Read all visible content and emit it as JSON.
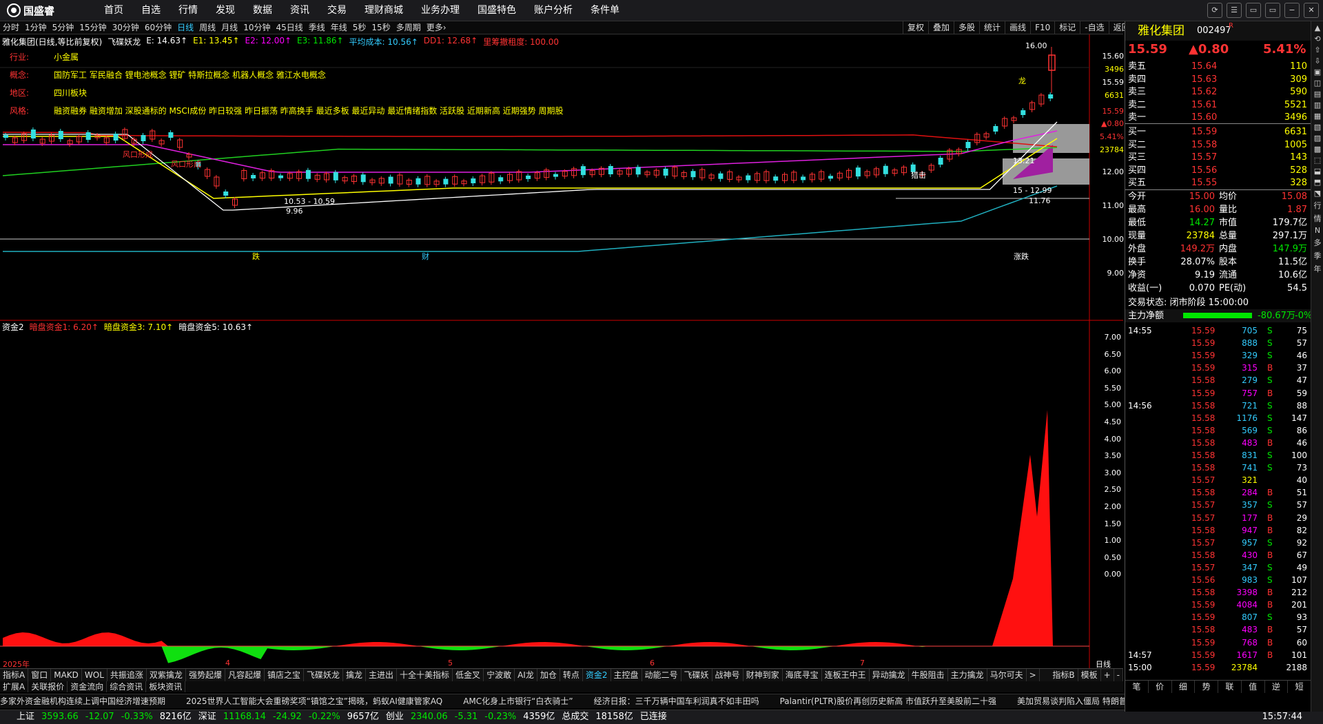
{
  "topbar": {
    "logo": "国盛睿",
    "menu": [
      "首页",
      "自选",
      "行情",
      "发现",
      "数据",
      "资讯",
      "交易",
      "理财商城",
      "业务办理",
      "国盛特色",
      "账户分析",
      "条件单"
    ],
    "window_buttons": [
      "⟳",
      "☰",
      "▭",
      "▭",
      "−",
      "✕"
    ]
  },
  "periods": [
    "分时",
    "1分钟",
    "5分钟",
    "15分钟",
    "30分钟",
    "60分钟",
    "日线",
    "周线",
    "月线",
    "10分钟",
    "45日线",
    "季线",
    "年线",
    "5秒",
    "15秒",
    "多周期",
    "更多›"
  ],
  "active_period": "日线",
  "right_tools": [
    "复权",
    "叠加",
    "多股",
    "统计",
    "画线",
    "F10",
    "标记",
    "-自选",
    "返回"
  ],
  "info_line": {
    "stock": "雅化集团(日线,等比前复权)",
    "indicator": "飞碟妖龙",
    "E": "E: 14.63↑",
    "E1": "E1: 13.45↑",
    "E2": "E2: 12.00↑",
    "E3": "E3: 11.86↑",
    "avg_cost": "平均成本: 10.56↑",
    "DD1": "DD1: 12.68↑",
    "lock": "里筹撤租度: 100.00"
  },
  "stock_profile": [
    {
      "label": "行业:",
      "value": "小金属"
    },
    {
      "label": "概念:",
      "value": "国防军工 军民融合 锂电池概念 锂矿 特斯拉概念 机器人概念 雅江水电概念"
    },
    {
      "label": "地区:",
      "value": "四川板块"
    },
    {
      "label": "风格:",
      "value": "融资融券 融资增加 深股通标的 MSCI成份 昨日较强 昨日振荡 昨高换手 最近多板 最近异动 最近情绪指数 活跃股 近期新高 近期强势 周期股"
    }
  ],
  "price_axis": [
    "15.60",
    "3496",
    "15.59",
    "6631",
    "15.59",
    "▲0.80",
    "5.41%",
    "23784",
    "12.00",
    "11.00",
    "10.00",
    "9.00"
  ],
  "price_annotations": {
    "high": "16.00",
    "low_range": "10.53 - 10.59",
    "low": "9.96",
    "mid1": "13.21",
    "mid2": "15 - 12.99",
    "mid3": "11.76",
    "wind1": "风口形成",
    "wind2": "风口形成",
    "dragon": "龙",
    "hunt": "猎击",
    "event1": "跌",
    "event2": "财",
    "event3": "涨跌"
  },
  "sub_indicator": {
    "name": "资金2",
    "v1": "暗盘资金1: 6.20↑",
    "v2": "暗盘资金3: 7.10↑",
    "v3": "暗盘资金5: 10.63↑"
  },
  "sub_axis": [
    "7.00",
    "6.50",
    "6.00",
    "5.50",
    "5.00",
    "4.50",
    "4.00",
    "3.50",
    "3.00",
    "2.50",
    "2.00",
    "1.50",
    "1.00",
    "0.50",
    "0.00"
  ],
  "date_axis": [
    "2025年",
    "4",
    "5",
    "6",
    "7"
  ],
  "date_right": "日线",
  "tabs_row1": [
    "指标A",
    "窗口",
    "MAKD",
    "WOL",
    "共振追涨",
    "双紫擒龙",
    "强势起爆",
    "凡容起爆",
    "镇店之宝",
    "飞碟妖龙",
    "擒龙",
    "主进出",
    "十全十美指标",
    "低金叉",
    "宁波敢",
    "AI龙",
    "加仓",
    "转点",
    "资金2",
    "主控盘",
    "动能二号",
    "飞碟妖",
    "战神号",
    "财神到家",
    "海底寻宝",
    "连板王中王",
    "异动擒龙",
    "牛股阻击",
    "主力擒龙",
    "马尔可夫",
    ">"
  ],
  "tabs_row1_right": [
    "指标B",
    "模板",
    "+",
    "-"
  ],
  "tabs_row2": [
    "扩展A",
    "关联报价",
    "资金流向",
    "综合资讯",
    "板块资讯"
  ],
  "news": [
    "多家外资金融机构连续上调中国经济增速预期",
    "2025世界人工智能大会重磅奖项“镇馆之宝”揭晓，蚂蚁AI健康管家AQ",
    "AMC化身上市银行“白衣骑士”",
    "经济日报：三千万辆中国车利润真不如丰田吗",
    "Palantir(PLTR)股价再创历史新高 市值跃升至美股前二十强",
    "美加贸易谈判陷入僵局 特朗普威胁对加拿大征收更高关税"
  ],
  "status": {
    "sh_label": "上证",
    "sh_price": "3593.66",
    "sh_chg": "-12.07",
    "sh_pct": "-0.33%",
    "sh_amt": "8216亿",
    "sz_label": "深证",
    "sz_price": "11168.14",
    "sz_chg": "-24.92",
    "sz_pct": "-0.22%",
    "sz_amt": "9657亿",
    "cy_label": "创业",
    "cy_price": "2340.06",
    "cy_chg": "-5.31",
    "cy_pct": "-0.23%",
    "cy_amt": "4359亿",
    "total_label": "总成交",
    "total": "18158亿",
    "conn": "已连接",
    "time": "15:57:44"
  },
  "quote": {
    "name": "雅化集团",
    "code": "002497",
    "tag": "R",
    "price": "15.59",
    "change": "▲0.80",
    "pct": "5.41%",
    "asks": [
      {
        "label": "卖五",
        "price": "15.64",
        "vol": "110"
      },
      {
        "label": "卖四",
        "price": "15.63",
        "vol": "309"
      },
      {
        "label": "卖三",
        "price": "15.62",
        "vol": "590"
      },
      {
        "label": "卖二",
        "price": "15.61",
        "vol": "5521"
      },
      {
        "label": "卖一",
        "price": "15.60",
        "vol": "3496"
      }
    ],
    "bids": [
      {
        "label": "买一",
        "price": "15.59",
        "vol": "6631"
      },
      {
        "label": "买二",
        "price": "15.58",
        "vol": "1005"
      },
      {
        "label": "买三",
        "price": "15.57",
        "vol": "143"
      },
      {
        "label": "买四",
        "price": "15.56",
        "vol": "528"
      },
      {
        "label": "买五",
        "price": "15.55",
        "vol": "328"
      }
    ],
    "stats": [
      {
        "l1": "今开",
        "v1": "15.00",
        "l2": "均价",
        "v2": "15.08"
      },
      {
        "l1": "最高",
        "v1": "16.00",
        "l2": "量比",
        "v2": "1.87"
      },
      {
        "l1": "最低",
        "v1": "14.27",
        "l2": "市值",
        "v2": "179.7亿"
      },
      {
        "l1": "现量",
        "v1": "23784",
        "l2": "总量",
        "v2": "297.1万"
      },
      {
        "l1": "外盘",
        "v1": "149.2万",
        "l2": "内盘",
        "v2": "147.9万"
      },
      {
        "l1": "换手",
        "v1": "28.07%",
        "l2": "股本",
        "v2": "11.5亿"
      },
      {
        "l1": "净资",
        "v1": "9.19",
        "l2": "流通",
        "v2": "10.6亿"
      },
      {
        "l1": "收益(一)",
        "v1": "0.070",
        "l2": "PE(动)",
        "v2": "54.5"
      }
    ],
    "trade_state": "交易状态: 闭市阶段 15:00:00",
    "main_net_label": "主力净额",
    "main_net": "-80.67万",
    "main_net_pct": "-0%",
    "ticks": [
      {
        "t": "14:55",
        "p": "15.59",
        "v": "705",
        "d": "S",
        "n": "75"
      },
      {
        "t": "",
        "p": "15.59",
        "v": "888",
        "d": "S",
        "n": "57"
      },
      {
        "t": "",
        "p": "15.59",
        "v": "329",
        "d": "S",
        "n": "46"
      },
      {
        "t": "",
        "p": "15.59",
        "v": "315",
        "d": "B",
        "n": "37"
      },
      {
        "t": "",
        "p": "15.58",
        "v": "279",
        "d": "S",
        "n": "47"
      },
      {
        "t": "",
        "p": "15.59",
        "v": "757",
        "d": "B",
        "n": "59"
      },
      {
        "t": "14:56",
        "p": "15.58",
        "v": "721",
        "d": "S",
        "n": "88"
      },
      {
        "t": "",
        "p": "15.58",
        "v": "1176",
        "d": "S",
        "n": "147"
      },
      {
        "t": "",
        "p": "15.58",
        "v": "569",
        "d": "S",
        "n": "86"
      },
      {
        "t": "",
        "p": "15.58",
        "v": "483",
        "d": "B",
        "n": "46"
      },
      {
        "t": "",
        "p": "15.58",
        "v": "831",
        "d": "S",
        "n": "100"
      },
      {
        "t": "",
        "p": "15.58",
        "v": "741",
        "d": "S",
        "n": "73"
      },
      {
        "t": "",
        "p": "15.57",
        "v": "321",
        "d": "",
        "n": "40"
      },
      {
        "t": "",
        "p": "15.58",
        "v": "284",
        "d": "B",
        "n": "51"
      },
      {
        "t": "",
        "p": "15.57",
        "v": "357",
        "d": "S",
        "n": "57"
      },
      {
        "t": "",
        "p": "15.57",
        "v": "177",
        "d": "B",
        "n": "29"
      },
      {
        "t": "",
        "p": "15.58",
        "v": "947",
        "d": "B",
        "n": "82"
      },
      {
        "t": "",
        "p": "15.57",
        "v": "957",
        "d": "S",
        "n": "92"
      },
      {
        "t": "",
        "p": "15.58",
        "v": "430",
        "d": "B",
        "n": "67"
      },
      {
        "t": "",
        "p": "15.57",
        "v": "347",
        "d": "S",
        "n": "49"
      },
      {
        "t": "",
        "p": "15.56",
        "v": "983",
        "d": "S",
        "n": "107"
      },
      {
        "t": "",
        "p": "15.58",
        "v": "3398",
        "d": "B",
        "n": "212"
      },
      {
        "t": "",
        "p": "15.59",
        "v": "4084",
        "d": "B",
        "n": "201"
      },
      {
        "t": "",
        "p": "15.59",
        "v": "807",
        "d": "S",
        "n": "93"
      },
      {
        "t": "",
        "p": "15.58",
        "v": "483",
        "d": "B",
        "n": "57"
      },
      {
        "t": "",
        "p": "15.59",
        "v": "768",
        "d": "B",
        "n": "60"
      },
      {
        "t": "14:57",
        "p": "15.59",
        "v": "1617",
        "d": "B",
        "n": "101"
      },
      {
        "t": "15:00",
        "p": "15.59",
        "v": "23784",
        "d": "",
        "n": "2188"
      }
    ],
    "bottom_tabs": [
      "笔",
      "价",
      "细",
      "势",
      "联",
      "值",
      "逆",
      "短"
    ]
  },
  "sidebar": [
    "▲",
    "⟲",
    "⇧",
    "⇩",
    "▣",
    "◫",
    "▤",
    "▥",
    "▦",
    "▧",
    "▨",
    "▩",
    "⬚",
    "⬓",
    "⬒",
    "⬔",
    "行",
    "情",
    "N",
    "多",
    "季",
    "年"
  ],
  "colors": {
    "up": "#ff3333",
    "down": "#00e600",
    "accent": "#33ccff",
    "yellow": "#ffff00",
    "magenta": "#ff00ff"
  }
}
